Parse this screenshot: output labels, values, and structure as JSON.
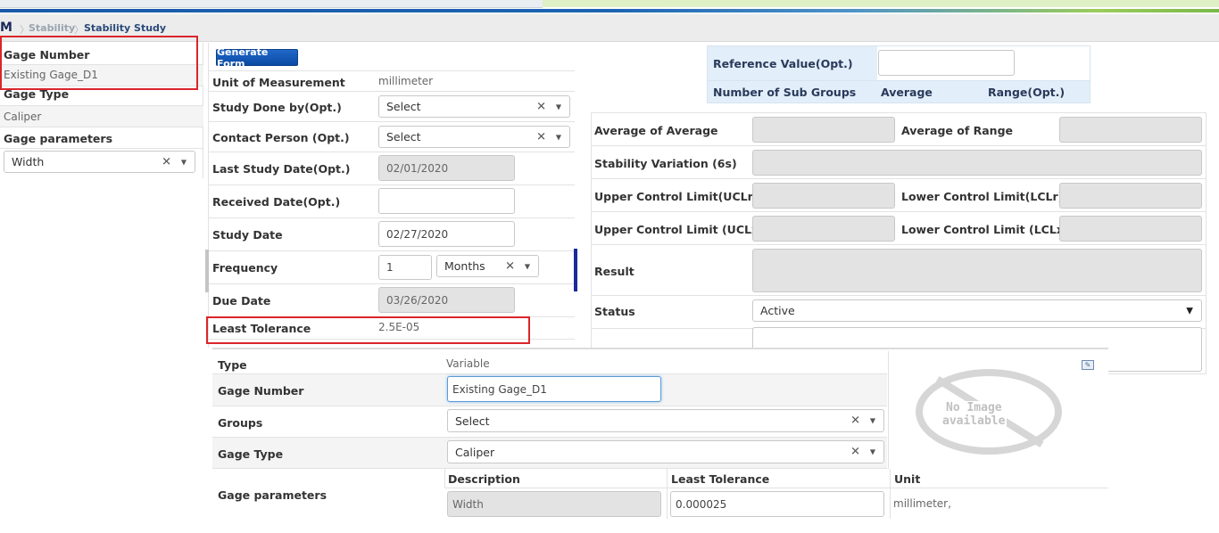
{
  "breadcrumb": {
    "logo": "M",
    "items": [
      "Stability",
      "Stability Study"
    ]
  },
  "left_panel": {
    "gage_number_label": "Gage Number",
    "gage_number_value": "Existing Gage_D1",
    "gage_type_label": "Gage Type",
    "gage_type_value": "Caliper",
    "gage_params_label": "Gage parameters",
    "gage_params_value": "Width"
  },
  "center_form": {
    "generate_button": "Generate Form",
    "unit_label": "Unit of Measurement",
    "unit_value": "millimeter",
    "study_done_label": "Study Done by(Opt.)",
    "study_done_value": "Select",
    "contact_label": "Contact Person (Opt.)",
    "contact_value": "Select",
    "last_study_label": "Last Study Date(Opt.)",
    "last_study_value": "02/01/2020",
    "received_label": "Received Date(Opt.)",
    "received_value": "",
    "study_date_label": "Study Date",
    "study_date_value": "02/27/2020",
    "frequency_label": "Frequency",
    "frequency_value": "1",
    "frequency_unit": "Months",
    "due_date_label": "Due Date",
    "due_date_value": "03/26/2020",
    "least_tol_label": "Least Tolerance",
    "least_tol_value": "2.5E-05"
  },
  "right_top": {
    "ref_label": "Reference Value(Opt.)",
    "ref_value": "",
    "subgroups_label": "Number of Sub Groups",
    "average_label": "Average",
    "range_label": "Range(Opt.)"
  },
  "right_results": {
    "avg_avg_label": "Average of Average",
    "avg_range_label": "Average of Range",
    "stability_label": "Stability Variation (6s)",
    "uclr_label": "Upper Control Limit(UCLr)",
    "lclr_label": "Lower Control Limit(LCLr)",
    "uclx_label": "Upper Control Limit (UCLx)",
    "lclx_label": "Lower Control Limit (LCLx)",
    "result_label": "Result",
    "status_label": "Status",
    "status_value": "Active"
  },
  "popup": {
    "type_label": "Type",
    "type_value": "Variable",
    "gage_number_label": "Gage Number",
    "gage_number_value": "Existing Gage_D1",
    "groups_label": "Groups",
    "groups_value": "Select",
    "gage_type_label": "Gage Type",
    "gage_type_value": "Caliper",
    "params_label": "Gage parameters",
    "col_description": "Description",
    "col_least_tol": "Least Tolerance",
    "col_unit": "Unit",
    "param_desc": "Width",
    "param_tol": "0.000025",
    "param_unit": "millimeter,",
    "no_image_line1": "No Image",
    "no_image_line2": "available"
  },
  "colors": {
    "accent_blue": "#0b4aa3",
    "highlight_red": "#d9262c",
    "header_blue_bg": "#e2eef9"
  }
}
